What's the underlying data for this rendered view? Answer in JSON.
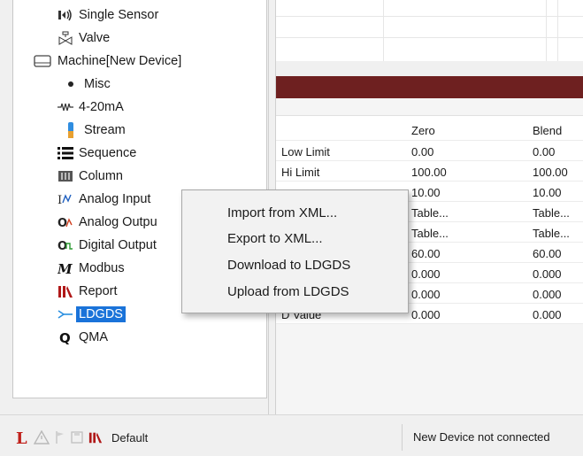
{
  "tree": {
    "items": [
      {
        "label": "Single Sensor",
        "icon": "single-sensor-icon"
      },
      {
        "label": "Valve",
        "icon": "valve-icon"
      },
      {
        "label": "Machine[New Device]",
        "icon": "machine-icon"
      },
      {
        "label": "Misc",
        "icon": "bullet-icon"
      },
      {
        "label": "4-20mA",
        "icon": "resistor-icon"
      },
      {
        "label": "Stream",
        "icon": "stream-icon"
      },
      {
        "label": "Sequence",
        "icon": "sequence-icon"
      },
      {
        "label": "Column",
        "icon": "column-icon"
      },
      {
        "label": "Analog Input",
        "icon": "analog-input-icon"
      },
      {
        "label": "Analog Outpu",
        "icon": "analog-output-icon"
      },
      {
        "label": "Digital Output",
        "icon": "digital-output-icon"
      },
      {
        "label": "Modbus",
        "icon": "modbus-icon"
      },
      {
        "label": "Report",
        "icon": "report-icon"
      },
      {
        "label": "LDGDS",
        "icon": "ldgds-icon"
      },
      {
        "label": "QMA",
        "icon": "qma-icon"
      }
    ],
    "selected": "LDGDS"
  },
  "context_menu": {
    "items": [
      "Import from XML...",
      "Export to XML...",
      "Download to LDGDS",
      "Upload from LDGDS"
    ]
  },
  "table": {
    "headers": [
      "",
      "Zero",
      "Blend"
    ],
    "rows": [
      [
        "Low Limit",
        "0.00",
        "0.00"
      ],
      [
        "Hi Limit",
        "100.00",
        "100.00"
      ],
      [
        "",
        "10.00",
        "10.00"
      ],
      [
        "",
        "Table...",
        "Table..."
      ],
      [
        "",
        "Table...",
        "Table..."
      ],
      [
        "",
        "60.00",
        "60.00"
      ],
      [
        "",
        "0.000",
        "0.000"
      ],
      [
        "",
        "0.000",
        "0.000"
      ],
      [
        "D Value",
        "0.000",
        "0.000"
      ]
    ]
  },
  "status": {
    "profile": "Default",
    "connection": "New Device not connected"
  },
  "colors": {
    "accent_bar": "#6e2020",
    "selection": "#1a73d9",
    "brand_red": "#c0201a"
  }
}
